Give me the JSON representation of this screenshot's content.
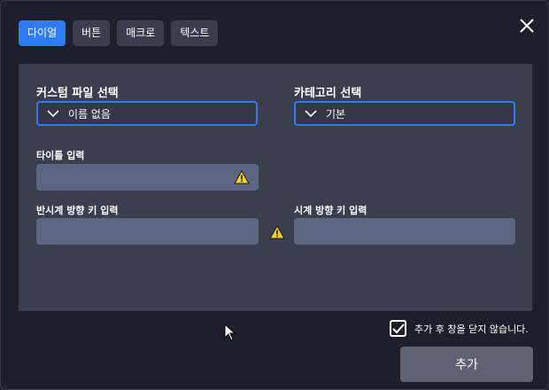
{
  "tabs": [
    {
      "label": "다이얼",
      "active": true
    },
    {
      "label": "버튼",
      "active": false
    },
    {
      "label": "매크로",
      "active": false
    },
    {
      "label": "텍스트",
      "active": false
    }
  ],
  "form": {
    "custom_file_label": "커스텀 파일 선택",
    "custom_file_value": "이름 없음",
    "category_label": "카테고리 선택",
    "category_value": "기본",
    "title_label": "타이틀 입력",
    "title_value": "",
    "ccw_label": "반시계 방향 키 입력",
    "ccw_value": "",
    "cw_label": "시계 방향 키 입력",
    "cw_value": ""
  },
  "footer": {
    "keep_open_label": "추가 후 창을 닫지 않습니다.",
    "keep_open_checked": true,
    "add_button": "추가"
  },
  "icons": {
    "close": "close-icon",
    "warning": "warning-icon",
    "chevron": "chevron-down-icon"
  },
  "colors": {
    "accent": "#2f7bf5",
    "warning": "#f5d020"
  }
}
